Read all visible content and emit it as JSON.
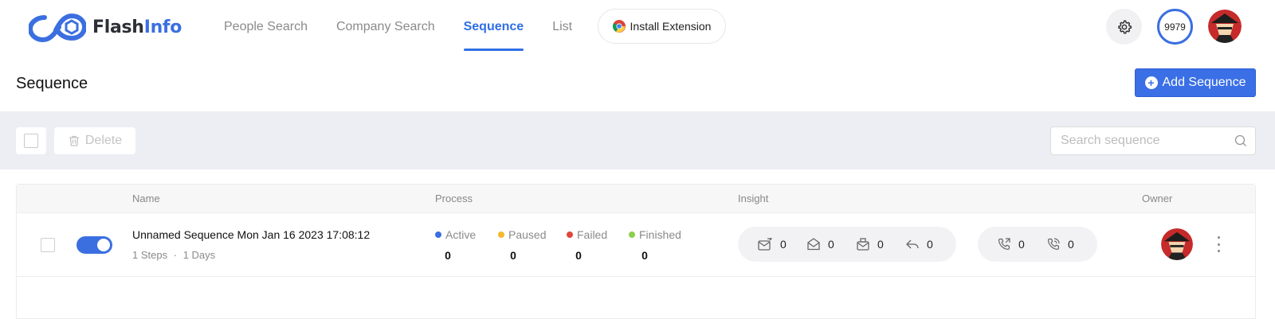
{
  "brand": {
    "name_part1": "Flash",
    "name_part2": "Info",
    "brand_color": "#3b6fe0"
  },
  "nav": {
    "items": [
      {
        "label": "People Search",
        "active": false
      },
      {
        "label": "Company Search",
        "active": false
      },
      {
        "label": "Sequence",
        "active": true
      },
      {
        "label": "List",
        "active": false
      }
    ],
    "install_extension_label": "Install Extension"
  },
  "header": {
    "settings_icon": "gear-icon",
    "credits": "9979"
  },
  "page": {
    "title": "Sequence",
    "add_button_label": "Add Sequence"
  },
  "toolbar": {
    "delete_label": "Delete",
    "search_placeholder": "Search sequence",
    "search_value": ""
  },
  "table": {
    "columns": {
      "name": "Name",
      "process": "Process",
      "insight": "Insight",
      "owner": "Owner"
    },
    "rows": [
      {
        "enabled": true,
        "name": "Unnamed Sequence Mon Jan 16 2023 17:08:12",
        "steps": "1 Steps",
        "separator": "·",
        "days": "1 Days",
        "process": {
          "active_label": "Active",
          "active": "0",
          "paused_label": "Paused",
          "paused": "0",
          "failed_label": "Failed",
          "failed": "0",
          "finished_label": "Finished",
          "finished": "0"
        },
        "insight_email": {
          "sent": "0",
          "opened": "0",
          "clicked": "0",
          "replied": "0"
        },
        "insight_call": {
          "calls": "0",
          "connected": "0"
        }
      }
    ]
  },
  "status_colors": {
    "active": "#3b6fe0",
    "paused": "#f5b82e",
    "failed": "#e0473c",
    "finished": "#8ccf4d"
  }
}
